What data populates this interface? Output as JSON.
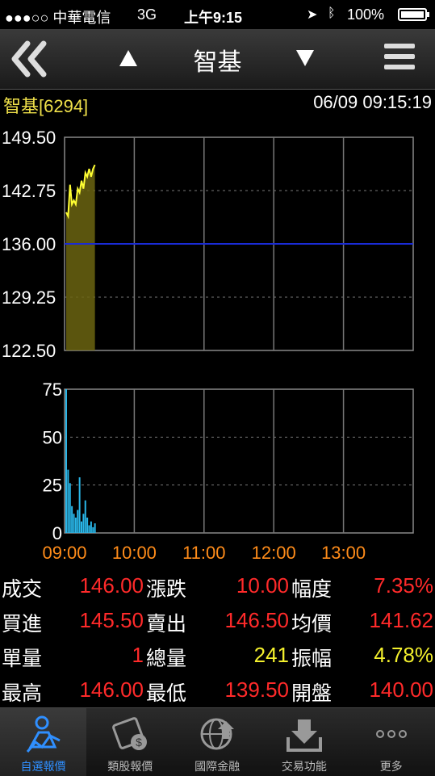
{
  "status": {
    "carrier": "●●●○○ 中華電信",
    "network": "3G",
    "time": "上午9:15",
    "battery": "100%",
    "battery_level": 1.0
  },
  "nav": {
    "title": "智基"
  },
  "stock": {
    "name": "智基[6294]",
    "datetime": "06/09 09:15:19"
  },
  "colors": {
    "up": "#ff2a2a",
    "price_line": "#ffff33",
    "ref_line": "#1a2bd6",
    "volume": "#29b6e8",
    "time_label": "#ff8c1a",
    "active_tab": "#2f8fff"
  },
  "chart_data": [
    {
      "type": "area",
      "ylim": [
        122.5,
        149.5
      ],
      "ytick_labels": [
        "149.50",
        "142.75",
        "136.00",
        "129.25",
        "122.50"
      ],
      "reference": 136.0,
      "x": [
        "09:00",
        "09:01",
        "09:02",
        "09:03",
        "09:04",
        "09:05",
        "09:06",
        "09:07",
        "09:08",
        "09:09",
        "09:10",
        "09:11",
        "09:12",
        "09:13",
        "09:14",
        "09:15"
      ],
      "values": [
        140.0,
        139.5,
        143.5,
        141.0,
        141.5,
        141.0,
        143.0,
        142.5,
        144.0,
        143.0,
        145.0,
        144.5,
        145.5,
        144.5,
        145.5,
        146.0
      ]
    },
    {
      "type": "bar",
      "ylim": [
        0,
        75
      ],
      "ytick_labels": [
        "75",
        "50",
        "25",
        "0"
      ],
      "x": [
        "09:00",
        "09:01",
        "09:02",
        "09:03",
        "09:04",
        "09:05",
        "09:06",
        "09:07",
        "09:08",
        "09:09",
        "09:10",
        "09:11",
        "09:12",
        "09:13",
        "09:14",
        "09:15"
      ],
      "values": [
        75,
        33,
        26,
        14,
        10,
        8,
        12,
        29,
        6,
        10,
        17,
        8,
        4,
        6,
        3,
        5
      ],
      "xtick_labels": [
        "09:00",
        "10:00",
        "11:00",
        "12:00",
        "13:00"
      ]
    }
  ],
  "quotes": [
    [
      {
        "label": "成交",
        "value": "146.00",
        "color": "red"
      },
      {
        "label": "漲跌",
        "value": "10.00",
        "color": "red"
      },
      {
        "label": "幅度",
        "value": "7.35%",
        "color": "red"
      }
    ],
    [
      {
        "label": "買進",
        "value": "145.50",
        "color": "red"
      },
      {
        "label": "賣出",
        "value": "146.50",
        "color": "red"
      },
      {
        "label": "均價",
        "value": "141.62",
        "color": "red"
      }
    ],
    [
      {
        "label": "單量",
        "value": "1",
        "color": "red"
      },
      {
        "label": "總量",
        "value": "241",
        "color": "yellow"
      },
      {
        "label": "振幅",
        "value": "4.78%",
        "color": "yellow"
      }
    ],
    [
      {
        "label": "最高",
        "value": "146.00",
        "color": "red"
      },
      {
        "label": "最低",
        "value": "139.50",
        "color": "red"
      },
      {
        "label": "開盤",
        "value": "140.00",
        "color": "red"
      }
    ]
  ],
  "tabs": [
    {
      "label": "自選報價",
      "icon": "person-chart-icon",
      "active": true
    },
    {
      "label": "類股報價",
      "icon": "film-coin-icon",
      "active": false
    },
    {
      "label": "國際金融",
      "icon": "globe-icon",
      "active": false
    },
    {
      "label": "交易功能",
      "icon": "download-tray-icon",
      "active": false
    },
    {
      "label": "更多",
      "icon": "more-dots-icon",
      "active": false
    }
  ]
}
